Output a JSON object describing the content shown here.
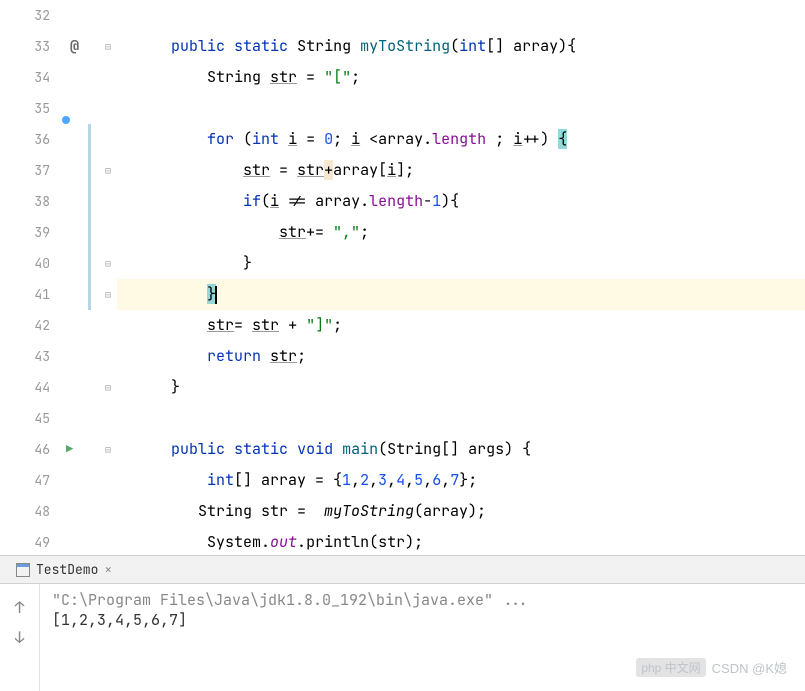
{
  "gutter": {
    "lines": [
      "32",
      "33",
      "34",
      "35",
      "36",
      "37",
      "38",
      "39",
      "40",
      "41",
      "42",
      "43",
      "44",
      "45",
      "46",
      "47",
      "48",
      "49"
    ]
  },
  "code": {
    "l33": {
      "kw1": "public",
      "kw2": "static",
      "type": "String",
      "method": "myToString",
      "kw3": "int",
      "param": "[] array){"
    },
    "l34": {
      "type": "String ",
      "var": "str",
      "rest": " = ",
      "str": "\"[\"",
      "semi": ";"
    },
    "l36": {
      "kw1": "for",
      "open": " (",
      "kw2": "int",
      "sp": " ",
      "i1": "i",
      "eq": " = ",
      "n0": "0",
      "sep1": "; ",
      "i2": "i",
      "cmp": " <array.",
      "len": "length",
      "sep2": " ; ",
      "i3": "i",
      "inc": "++) ",
      "brace": "{"
    },
    "l37": {
      "v1": "str",
      "eq": " = ",
      "v2": "str",
      "plus": "+",
      "arr": "array[",
      "i": "i",
      "close": "];"
    },
    "l38": {
      "kw": "if",
      "open": "(",
      "i": "i",
      "ne": " != array.",
      "len": "length",
      "m1": "-",
      "n1": "1",
      "close": "){"
    },
    "l39": {
      "v": "str",
      "pe": "+= ",
      "s": "\",\"",
      "semi": ";"
    },
    "l40": {
      "brace": "}"
    },
    "l41": {
      "brace": "}"
    },
    "l42": {
      "v1": "str",
      "eq": "= ",
      "v2": "str",
      "plus": " + ",
      "s": "\"]\"",
      "semi": ";"
    },
    "l43": {
      "kw": "return",
      "sp": " ",
      "v": "str",
      "semi": ";"
    },
    "l44": {
      "brace": "}"
    },
    "l46": {
      "kw1": "public",
      "kw2": "static",
      "kw3": "void",
      "method": "main",
      "sig": "(String[] args) {"
    },
    "l47": {
      "kw": "int",
      "arr": "[] array = {",
      "n1": "1",
      "n2": "2",
      "n3": "3",
      "n4": "4",
      "n5": "5",
      "n6": "6",
      "n7": "7",
      "close": "};",
      "c": ","
    },
    "l48": {
      "type": "String str =  ",
      "call": "myToString",
      "rest": "(array);"
    },
    "l49": {
      "sys": "System.",
      "out": "out",
      "dot": ".",
      "println": "println",
      "rest": "(str);"
    }
  },
  "tab": {
    "label": "TestDemo",
    "close": "×"
  },
  "console": {
    "line1": "\"C:\\Program Files\\Java\\jdk1.8.0_192\\bin\\java.exe\" ...",
    "line2": "[1,2,3,4,5,6,7]"
  },
  "watermark": {
    "logo": "php 中文网",
    "text": "CSDN @K媳"
  }
}
